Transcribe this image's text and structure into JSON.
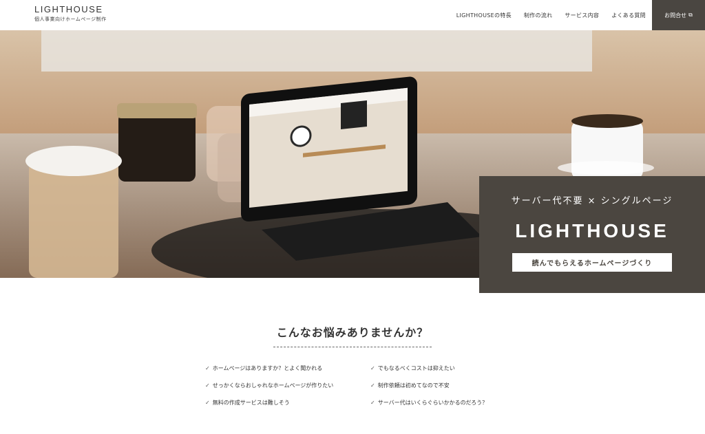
{
  "header": {
    "brand": "LIGHTHOUSE",
    "subtitle": "個人事業向けホームページ制作",
    "nav": [
      "LIGHTHOUSEの特長",
      "制作の流れ",
      "サービス内容",
      "よくある質問"
    ],
    "contact": "お問合せ"
  },
  "hero": {
    "subtitle": "サーバー代不要 × シングルページ",
    "title": "LIGHTHOUSE",
    "tagline": "読んでもらえるホームページづくり"
  },
  "worries": {
    "title": "こんなお悩みありませんか？",
    "items": [
      "ホームページはありますか？とよく聞かれる",
      "でもなるべくコストは抑えたい",
      "せっかくならおしゃれなホームページが作りたい",
      "制作依頼は初めてなので不安",
      "無料の作成サービスは難しそう",
      "サーバー代はいくらぐらいかかるのだろう？"
    ]
  },
  "colors": {
    "dark": "#4b4640",
    "accent": "#4a4641"
  },
  "icons": {
    "check": "check-icon",
    "external": "external-link-icon"
  }
}
